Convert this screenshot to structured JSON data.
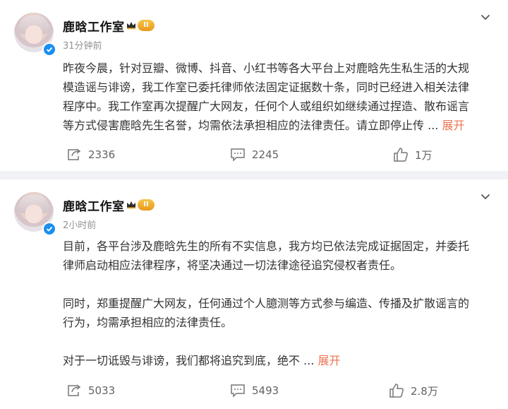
{
  "posts": [
    {
      "author": "鹿晗工作室",
      "badge": "II",
      "time": "31分钟前",
      "lines": [
        "昨夜今晨，针对豆瓣、微博、抖音、小红书等各大平台上对鹿晗先生私生活的大规",
        "模造谣与诽谤，我工作室已委托律师依法固定证据数十条，同时已经进入相关法律",
        "程序中。我工作室再次提醒广大网友，任何个人或组织如继续通过捏造、散布谣言",
        "等方式侵害鹿晗先生名誉，均需依法承担相应的法律责任。请立即停止传"
      ],
      "ellipsis": "...",
      "expand": "展开",
      "reposts": "2336",
      "comments": "2245",
      "likes": "1万"
    },
    {
      "author": "鹿晗工作室",
      "badge": "II",
      "time": "2小时前",
      "para1": [
        "目前，各平台涉及鹿晗先生的所有不实信息，我方均已依法完成证据固定，并委托",
        "律师启动相应法律程序，将坚决通过一切法律途径追究侵权者责任。"
      ],
      "para2": [
        "同时，郑重提醒广大网友，任何通过个人臆测等方式参与编造、传播及扩散谣言的",
        "行为，均需承担相应的法律责任。"
      ],
      "para3": "对于一切诋毁与诽谤，我们都将追究到底，绝不",
      "ellipsis": "...",
      "expand": "展开",
      "reposts": "5033",
      "comments": "5493",
      "likes": "2.8万"
    }
  ],
  "icons": {
    "repost": "repost-icon",
    "comment": "comment-icon",
    "like": "like-icon",
    "more": "chevron-down-icon",
    "verified": "verified-check-icon",
    "crown": "crown-icon"
  },
  "colors": {
    "accent": "#eb7350",
    "verified": "#1a8ff0",
    "badge": "#f0b030"
  }
}
